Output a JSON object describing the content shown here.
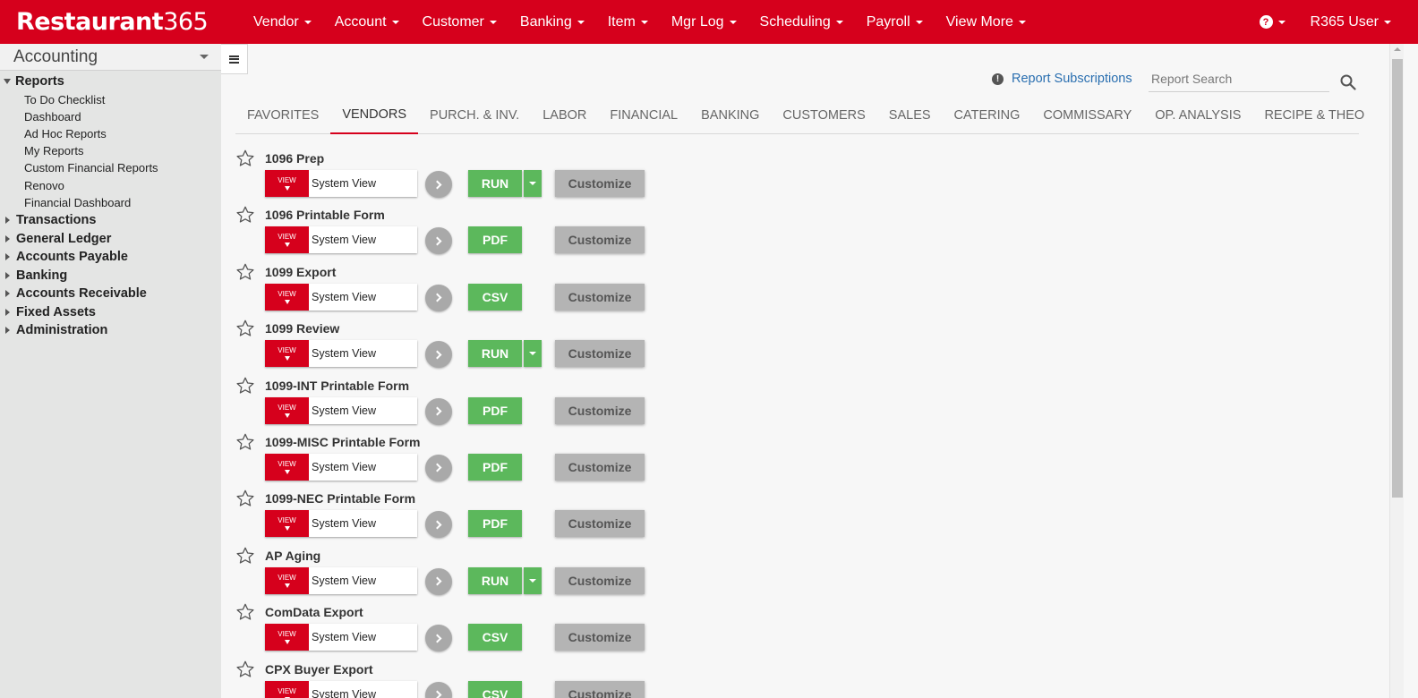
{
  "app": {
    "logo_text": "Restaurant",
    "logo_num": "365"
  },
  "nav": [
    {
      "label": "Vendor"
    },
    {
      "label": "Account"
    },
    {
      "label": "Customer"
    },
    {
      "label": "Banking"
    },
    {
      "label": "Item"
    },
    {
      "label": "Mgr Log"
    },
    {
      "label": "Scheduling"
    },
    {
      "label": "Payroll"
    },
    {
      "label": "View More"
    }
  ],
  "help": {
    "icon": "question-circle-icon",
    "glyph": "?"
  },
  "user": {
    "label": "R365 User"
  },
  "sidebar": {
    "module": "Accounting",
    "reports_label": "Reports",
    "report_items": [
      "To Do Checklist",
      "Dashboard",
      "Ad Hoc Reports",
      "My Reports",
      "Custom Financial Reports",
      "Renovo",
      "Financial Dashboard"
    ],
    "sections": [
      "Transactions",
      "General Ledger",
      "Accounts Payable",
      "Banking",
      "Accounts Receivable",
      "Fixed Assets",
      "Administration"
    ]
  },
  "header": {
    "subscriptions_label": "Report Subscriptions",
    "info_glyph": "!",
    "search_placeholder": "Report Search"
  },
  "tabs": [
    {
      "label": "FAVORITES",
      "active": false
    },
    {
      "label": "VENDORS",
      "active": true
    },
    {
      "label": "PURCH. & INV.",
      "active": false
    },
    {
      "label": "LABOR",
      "active": false
    },
    {
      "label": "FINANCIAL",
      "active": false
    },
    {
      "label": "BANKING",
      "active": false
    },
    {
      "label": "CUSTOMERS",
      "active": false
    },
    {
      "label": "SALES",
      "active": false
    },
    {
      "label": "CATERING",
      "active": false
    },
    {
      "label": "COMMISSARY",
      "active": false
    },
    {
      "label": "OP. ANALYSIS",
      "active": false
    },
    {
      "label": "RECIPE & THEO",
      "active": false
    }
  ],
  "view_button_label": "VIEW",
  "customize_label": "Customize",
  "reports": [
    {
      "name": "1096 Prep",
      "view": "System View",
      "action": "RUN",
      "has_dropdown": true
    },
    {
      "name": "1096 Printable Form",
      "view": "System View",
      "action": "PDF",
      "has_dropdown": false
    },
    {
      "name": "1099 Export",
      "view": "System View",
      "action": "CSV",
      "has_dropdown": false
    },
    {
      "name": "1099 Review",
      "view": "System View",
      "action": "RUN",
      "has_dropdown": true
    },
    {
      "name": "1099-INT Printable Form",
      "view": "System View",
      "action": "PDF",
      "has_dropdown": false
    },
    {
      "name": "1099-MISC Printable Form",
      "view": "System View",
      "action": "PDF",
      "has_dropdown": false
    },
    {
      "name": "1099-NEC Printable Form",
      "view": "System View",
      "action": "PDF",
      "has_dropdown": false
    },
    {
      "name": "AP Aging",
      "view": "System View",
      "action": "RUN",
      "has_dropdown": true
    },
    {
      "name": "ComData Export",
      "view": "System View",
      "action": "CSV",
      "has_dropdown": false
    },
    {
      "name": "CPX Buyer Export",
      "view": "System View",
      "action": "CSV",
      "has_dropdown": false
    }
  ],
  "colors": {
    "brand_red": "#d6001c",
    "run_green": "#5cb85c",
    "customize_gray": "#b4b4b4",
    "link_blue": "#2a6fb0"
  }
}
